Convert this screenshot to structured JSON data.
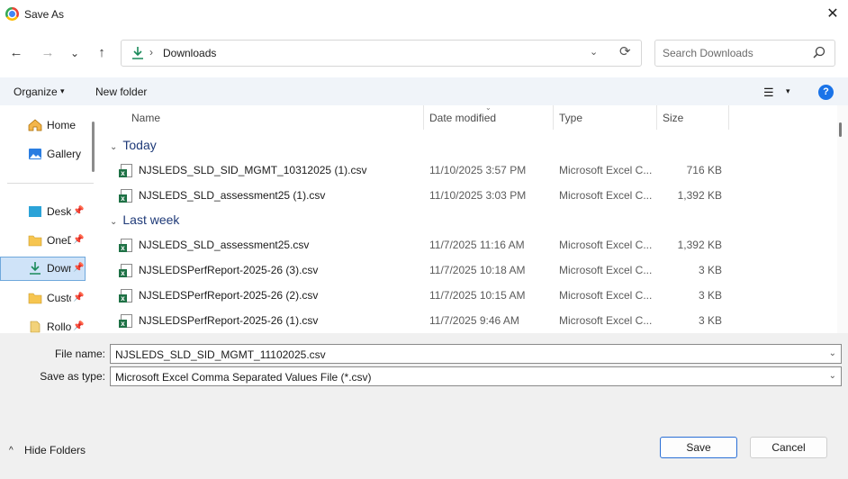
{
  "window": {
    "title": "Save As",
    "close_glyph": "✕"
  },
  "nav": {
    "back_glyph": "←",
    "forward_glyph": "→",
    "recent_glyph": "⌄",
    "up_glyph": "↑",
    "address": {
      "separator": "›",
      "location": "Downloads",
      "dropdown_glyph": "⌄",
      "refresh_glyph": "⟳"
    },
    "search_placeholder": "Search Downloads"
  },
  "toolbar": {
    "organize_label": "Organize",
    "new_folder_label": "New folder",
    "view_glyph": "☰",
    "caret_glyph": "▾",
    "help_glyph": "?"
  },
  "sidebar": {
    "items": [
      {
        "label": "Home",
        "icon": "home-icon"
      },
      {
        "label": "Gallery",
        "icon": "gallery-icon"
      },
      {
        "label": "Desktop",
        "icon": "desktop-icon",
        "pinned": true
      },
      {
        "label": "OneDrive",
        "icon": "folder-icon",
        "pinned": true
      },
      {
        "label": "Downloads",
        "icon": "download-icon",
        "pinned": true,
        "selected": true
      },
      {
        "label": "Custom",
        "icon": "folder-icon",
        "pinned": true
      },
      {
        "label": "Rollover",
        "icon": "document-icon",
        "pinned": true
      }
    ],
    "pin_glyph": "📌"
  },
  "list": {
    "columns": {
      "name": "Name",
      "date": "Date modified",
      "type": "Type",
      "size": "Size"
    },
    "groups": [
      {
        "label": "Today",
        "files": [
          {
            "name": "NJSLEDS_SLD_SID_MGMT_10312025 (1).csv",
            "date": "11/10/2025 3:57 PM",
            "type": "Microsoft Excel C...",
            "size": "716 KB"
          },
          {
            "name": "NJSLEDS_SLD_assessment25 (1).csv",
            "date": "11/10/2025 3:03 PM",
            "type": "Microsoft Excel C...",
            "size": "1,392 KB"
          }
        ]
      },
      {
        "label": "Last week",
        "files": [
          {
            "name": "NJSLEDS_SLD_assessment25.csv",
            "date": "11/7/2025 11:16 AM",
            "type": "Microsoft Excel C...",
            "size": "1,392 KB"
          },
          {
            "name": "NJSLEDSPerfReport-2025-26 (3).csv",
            "date": "11/7/2025 10:18 AM",
            "type": "Microsoft Excel C...",
            "size": "3 KB"
          },
          {
            "name": "NJSLEDSPerfReport-2025-26 (2).csv",
            "date": "11/7/2025 10:15 AM",
            "type": "Microsoft Excel C...",
            "size": "3 KB"
          },
          {
            "name": "NJSLEDSPerfReport-2025-26 (1).csv",
            "date": "11/7/2025 9:46 AM",
            "type": "Microsoft Excel C...",
            "size": "3 KB"
          }
        ]
      }
    ],
    "group_chevron": "⌄"
  },
  "form": {
    "filename_label": "File name:",
    "filename_value": "NJSLEDS_SLD_SID_MGMT_11102025.csv",
    "type_label": "Save as type:",
    "type_value": "Microsoft Excel Comma Separated Values File (*.csv)",
    "chevron": "⌄"
  },
  "footer": {
    "hide_folders_label": "Hide Folders",
    "caret_glyph": "^",
    "save_label": "Save",
    "cancel_label": "Cancel"
  },
  "colors": {
    "accent": "#1a73e8",
    "selected_bg": "#cfe3f8",
    "group_heading": "#1f3a78"
  }
}
